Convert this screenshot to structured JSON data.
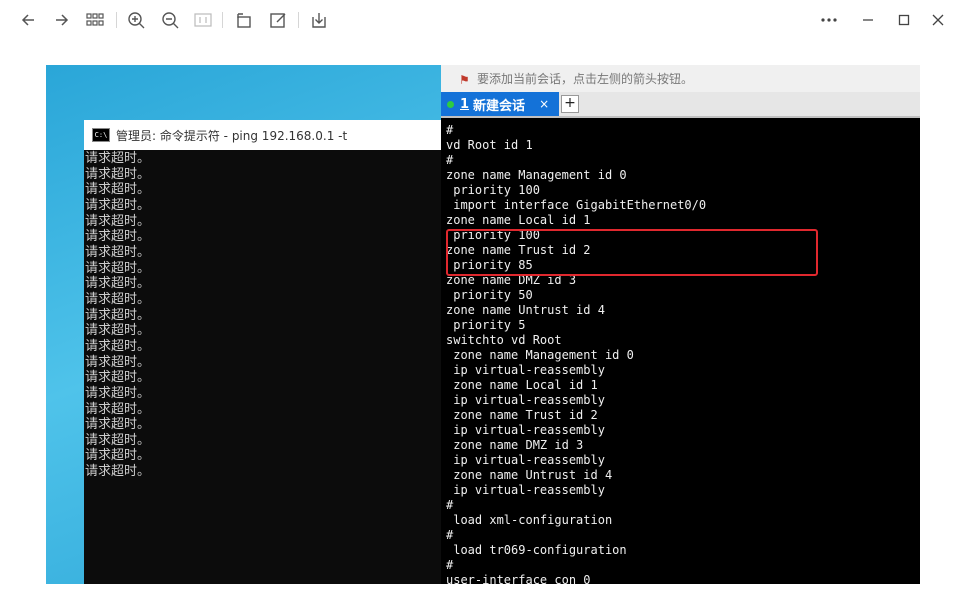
{
  "toolbar": {
    "icons": [
      "back-arrow-icon",
      "forward-arrow-icon",
      "grid-icon",
      "zoom-in-icon",
      "zoom-out-icon",
      "fit-icon",
      "rotate-icon",
      "edit-icon",
      "download-icon",
      "more-icon",
      "minimize-icon",
      "maximize-icon",
      "close-icon"
    ]
  },
  "cmd": {
    "title": "管理员: 命令提示符 - ping  192.168.0.1 -t",
    "icon_text": "C:\\",
    "lines": [
      "请求超时。",
      "请求超时。",
      "请求超时。",
      "请求超时。",
      "请求超时。",
      "请求超时。",
      "请求超时。",
      "请求超时。",
      "请求超时。",
      "请求超时。",
      "请求超时。",
      "请求超时。",
      "请求超时。",
      "请求超时。",
      "请求超时。",
      "请求超时。",
      "请求超时。",
      "请求超时。",
      "请求超时。",
      "请求超时。",
      "请求超时。"
    ]
  },
  "terminal": {
    "hint": "要添加当前会话，点击左侧的箭头按钮。",
    "tab_number": "1",
    "tab_label": "新建会话",
    "tab_close": "×",
    "tab_add": "+",
    "lines": [
      "#",
      "vd Root id 1",
      "#",
      "zone name Management id 0",
      " priority 100",
      " import interface GigabitEthernet0/0",
      "zone name Local id 1",
      " priority 100",
      "zone name Trust id 2",
      " priority 85",
      "zone name DMZ id 3",
      " priority 50",
      "zone name Untrust id 4",
      " priority 5",
      "switchto vd Root",
      " zone name Management id 0",
      " ip virtual-reassembly",
      " zone name Local id 1",
      " ip virtual-reassembly",
      " zone name Trust id 2",
      " ip virtual-reassembly",
      " zone name DMZ id 3",
      " ip virtual-reassembly",
      " zone name Untrust id 4",
      " ip virtual-reassembly",
      "#",
      " load xml-configuration",
      "#",
      " load tr069-configuration",
      "#",
      "user-interface con 0"
    ]
  },
  "colors": {
    "highlight": "#e0282e",
    "tab_active": "#1472d8",
    "desktop": "#2aa6d8"
  }
}
